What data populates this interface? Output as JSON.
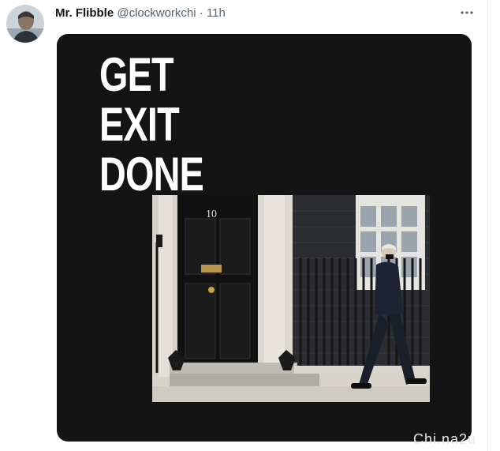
{
  "tweet": {
    "author_name": "Mr. Flibble",
    "handle": "@clockworkchi",
    "separator": "·",
    "time": "11h",
    "more_icon": "more-horizontal-icon"
  },
  "media": {
    "headline_lines": [
      "GET",
      "EXIT",
      "DONE"
    ],
    "door_number": "10"
  },
  "watermark": "Chi.na2u",
  "colors": {
    "media_bg": "#141414",
    "text_primary": "#0f1419",
    "text_secondary": "#536471"
  }
}
